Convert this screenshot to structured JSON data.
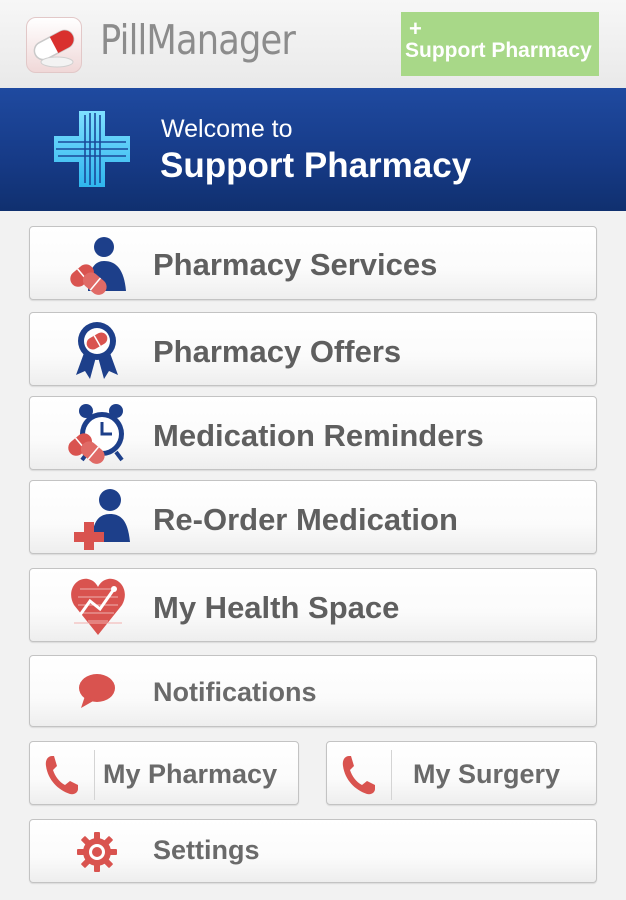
{
  "header": {
    "app_name": "PillManager",
    "brand_badge_plus": "+",
    "brand_badge_label": "Support Pharmacy"
  },
  "banner": {
    "welcome_line": "Welcome to",
    "pharmacy_name": "Support Pharmacy"
  },
  "menu": {
    "pharmacy_services": "Pharmacy Services",
    "pharmacy_offers": "Pharmacy Offers",
    "medication_reminders": "Medication Reminders",
    "reorder_medication": "Re-Order Medication",
    "health_space": "My Health Space",
    "notifications": "Notifications",
    "my_pharmacy": "My Pharmacy",
    "my_surgery": "My Surgery",
    "settings": "Settings"
  },
  "icons": {
    "app": "pill-icon",
    "banner": "pharmacy-cross-icon",
    "pharmacy_services": "pharmacist-pills-icon",
    "pharmacy_offers": "award-ribbon-icon",
    "medication_reminders": "alarm-clock-pills-icon",
    "reorder_medication": "person-plus-icon",
    "health_space": "heart-chart-icon",
    "notifications": "speech-bubble-icon",
    "my_pharmacy": "phone-icon",
    "my_surgery": "phone-icon",
    "settings": "gear-icon"
  },
  "colors": {
    "banner_blue": "#163a86",
    "icon_red": "#d9534f",
    "icon_navy": "#1d3f8a",
    "badge_green": "#a8d888",
    "label_gray": "#5f5f5f"
  }
}
